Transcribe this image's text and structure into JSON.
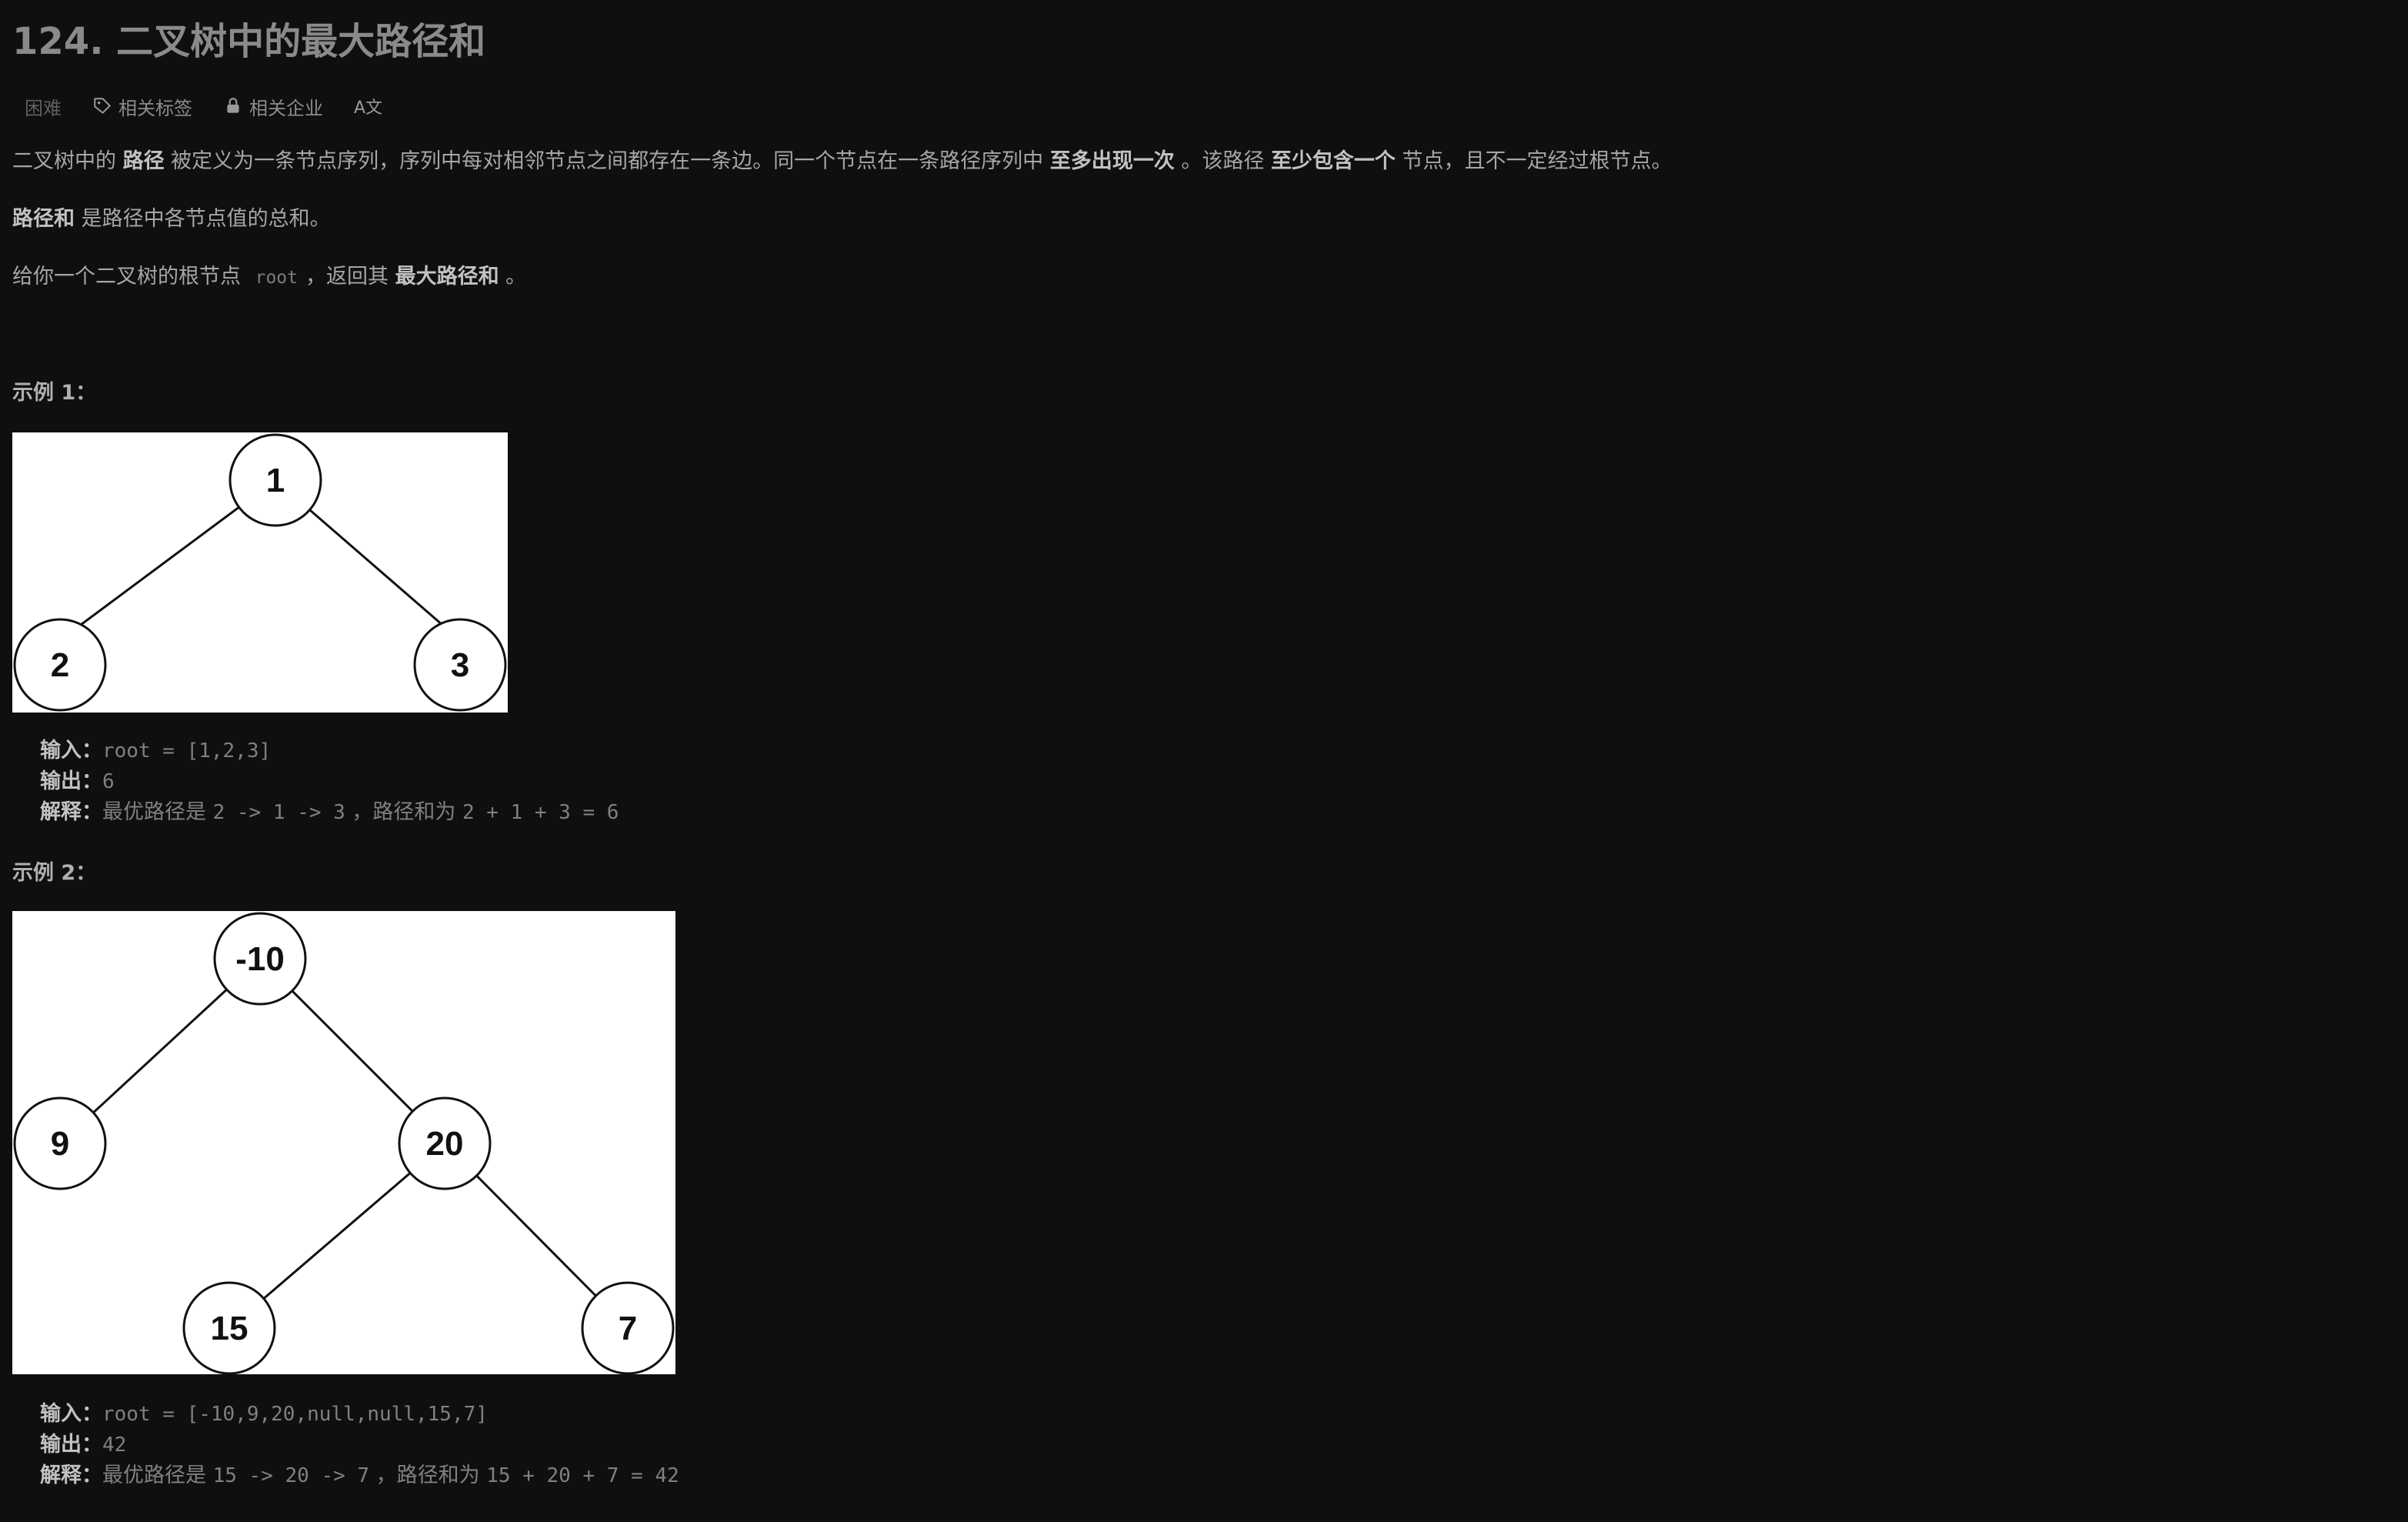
{
  "problem": {
    "title": "124. 二叉树中的最大路径和",
    "difficulty": "困难",
    "related_tags_label": "相关标签",
    "related_companies_label": "相关企业",
    "translate_label": "A文"
  },
  "description": {
    "p1": {
      "a": "二叉树中的 ",
      "b": "路径",
      "c": " 被定义为一条节点序列，序列中每对相邻节点之间都存在一条边。同一个节点在一条路径序列中 ",
      "d": "至多出现一次",
      "e": " 。该路径 ",
      "f": "至少包含一个",
      "g": " 节点，且不一定经过根节点。"
    },
    "p2": {
      "a": "路径和",
      "b": " 是路径中各节点值的总和。"
    },
    "p3": {
      "a": "给你一个二叉树的根节点 ",
      "code": "root",
      "b": "，返回其 ",
      "c": "最大路径和",
      "d": " 。"
    }
  },
  "examples": [
    {
      "title": "示例 1：",
      "tree_nodes": [
        "1",
        "2",
        "3"
      ],
      "input_label": "输入：",
      "input_value": "root = [1,2,3]",
      "output_label": "输出：",
      "output_value": "6",
      "explain_label": "解释：",
      "explain_prefix": "最优路径是 ",
      "explain_path": "2 -> 1 -> 3",
      "explain_mid": " ，路径和为 ",
      "explain_sum": "2 + 1 + 3 = 6"
    },
    {
      "title": "示例 2：",
      "tree_nodes": [
        "-10",
        "9",
        "20",
        "15",
        "7"
      ],
      "input_label": "输入：",
      "input_value": "root = [-10,9,20,null,null,15,7]",
      "output_label": "输出：",
      "output_value": "42",
      "explain_label": "解释：",
      "explain_prefix": "最优路径是 ",
      "explain_path": "15 -> 20 -> 7",
      "explain_mid": " ，路径和为 ",
      "explain_sum": "15 + 20 + 7 = 42"
    }
  ]
}
